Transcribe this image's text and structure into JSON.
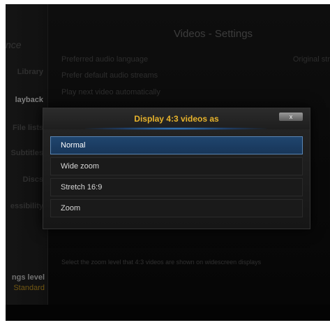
{
  "sidebar": {
    "title": "nce",
    "items": [
      {
        "label": "Library",
        "active": false
      },
      {
        "label": "layback",
        "active": true
      },
      {
        "label": "File lists",
        "active": false
      },
      {
        "label": "Subtitles",
        "active": false
      },
      {
        "label": "Discs",
        "active": false
      },
      {
        "label": "essibility",
        "active": false
      }
    ],
    "settings_level_label": "ngs level",
    "settings_level_value": "Standard"
  },
  "page": {
    "title": "Videos - Settings",
    "settings": [
      {
        "label": "Preferred audio language",
        "value": "Original str"
      },
      {
        "label": "Prefer default audio streams",
        "value": ""
      },
      {
        "label": "Play next video automatically",
        "value": ""
      }
    ],
    "hint": "Select the zoom level that 4:3 videos are shown on widescreen displays"
  },
  "dialog": {
    "title": "Display 4:3 videos as",
    "close_label": "x",
    "options": [
      {
        "label": "Normal",
        "selected": true
      },
      {
        "label": "Wide zoom",
        "selected": false
      },
      {
        "label": "Stretch 16:9",
        "selected": false
      },
      {
        "label": "Zoom",
        "selected": false
      }
    ]
  },
  "colors": {
    "accent": "#e7b32c",
    "selection": "#1f456e",
    "selection_border": "#5a86b5"
  }
}
